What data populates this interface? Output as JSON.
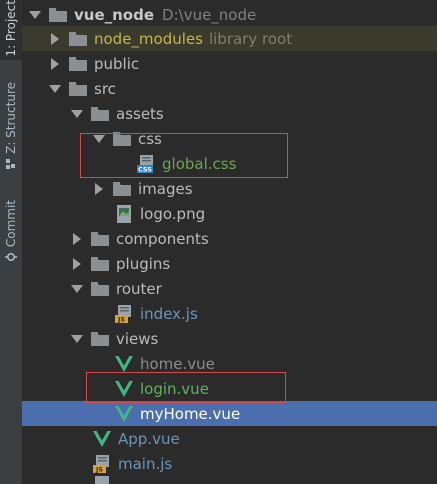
{
  "sidebar": {
    "project_tab": "1: Project",
    "structure_tab": "Z: Structure",
    "commit_tab": "Commit"
  },
  "tree": {
    "root": {
      "name": "vue_node",
      "path": "D:\\vue_node"
    },
    "node_modules": {
      "name": "node_modules",
      "hint": "library root"
    },
    "public": "public",
    "src": "src",
    "assets": "assets",
    "css": "css",
    "global_css": "global.css",
    "images": "images",
    "logo_png": "logo.png",
    "components": "components",
    "plugins": "plugins",
    "router": "router",
    "index_js": "index.js",
    "views": "views",
    "home_vue": "home.vue",
    "login_vue": "login.vue",
    "myhome_vue": "myHome.vue",
    "app_vue": "App.vue",
    "main_js": "main.js"
  },
  "icons": {
    "folder": "folder-icon",
    "css_file": "css-file-icon",
    "image_file": "image-file-icon",
    "js_file": "js-file-icon",
    "vue_file": "vue-icon"
  },
  "colors": {
    "background": "#2b2b2b",
    "selection": "#4b6eaf",
    "library_row": "#3a3a2d",
    "highlight_box": "#d24a4a",
    "vue_green": "#41b883"
  }
}
